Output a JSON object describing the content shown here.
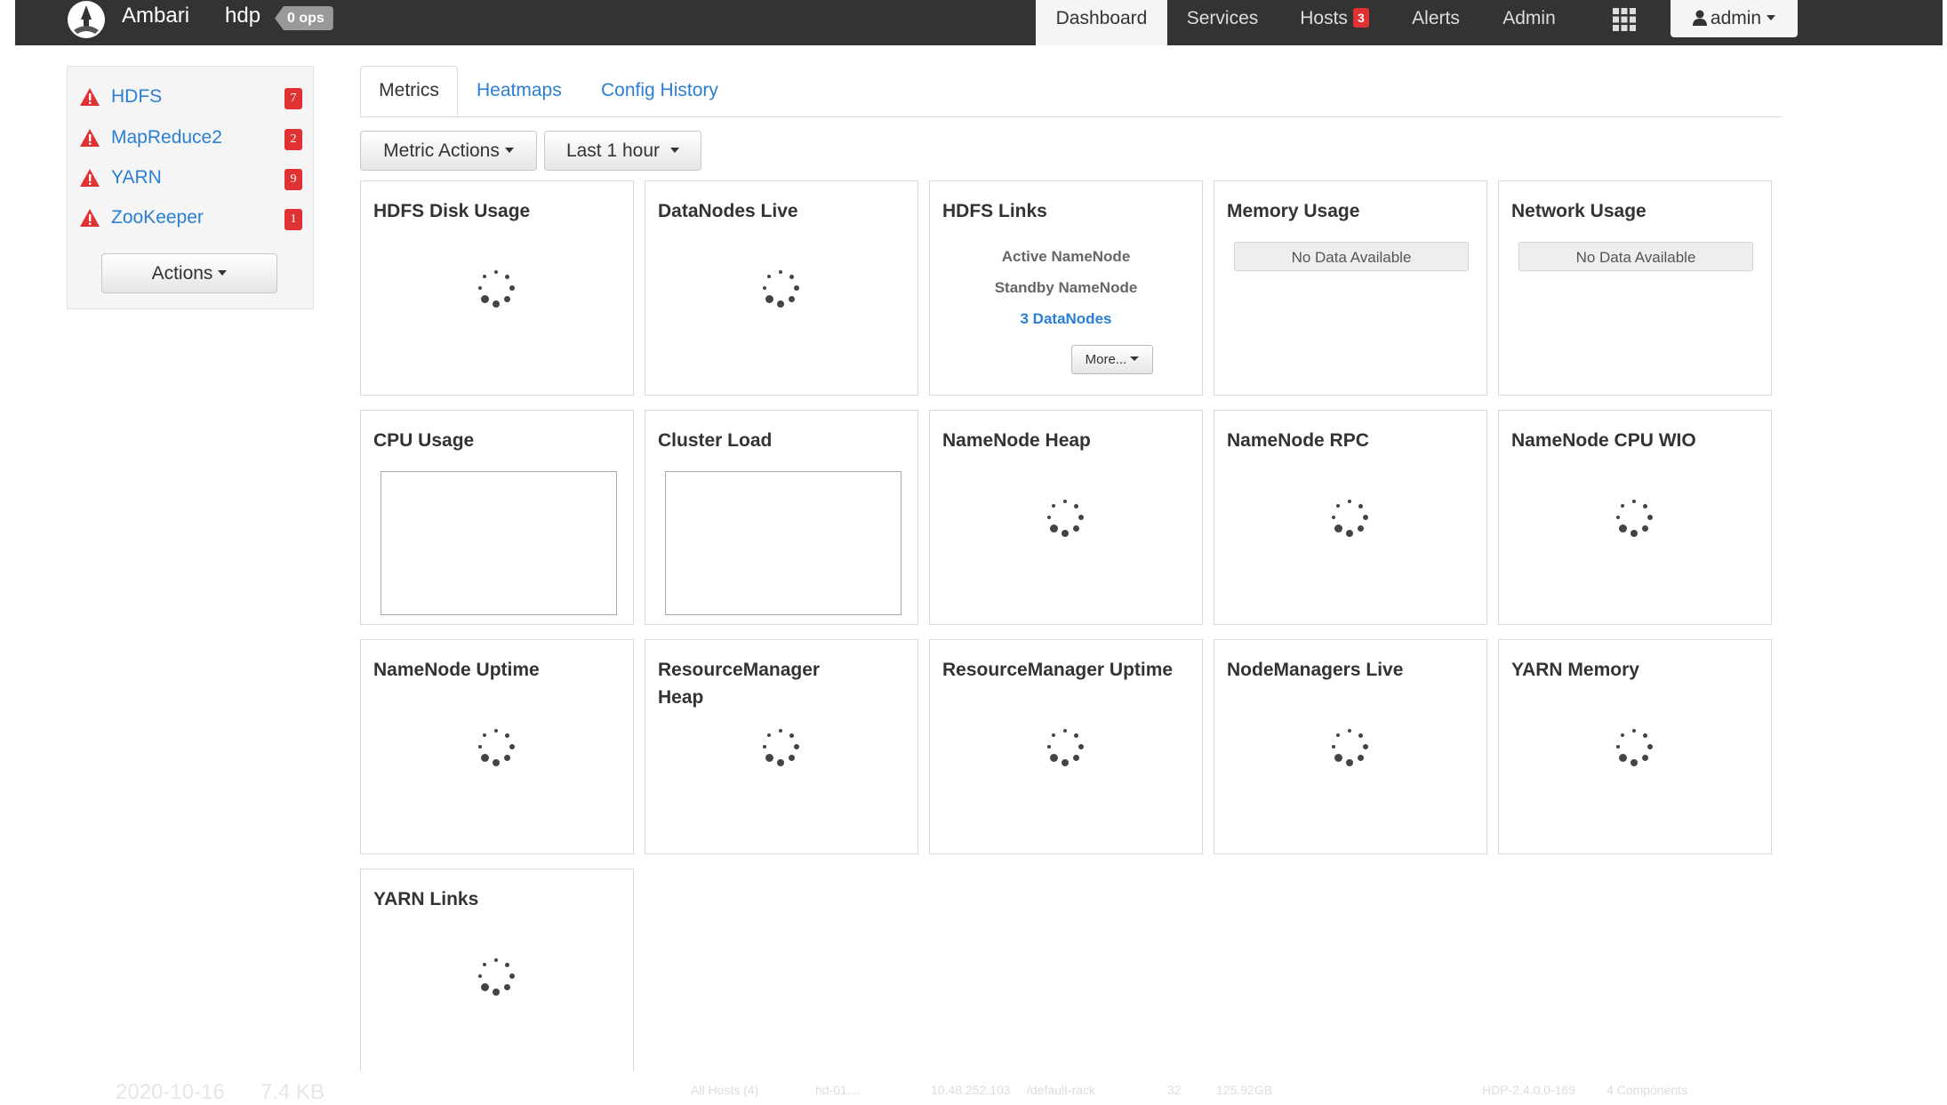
{
  "navbar": {
    "brand": "Ambari",
    "cluster": "hdp",
    "ops_badge": "0 ops",
    "items": [
      {
        "label": "Dashboard",
        "active": true
      },
      {
        "label": "Services"
      },
      {
        "label": "Hosts",
        "badge": "3"
      },
      {
        "label": "Alerts"
      },
      {
        "label": "Admin"
      }
    ],
    "user": "admin",
    "icons": {
      "logo": "ambari-logo-icon",
      "apps": "grid-icon",
      "user": "user-icon"
    }
  },
  "sidebar": {
    "services": [
      {
        "name": "HDFS",
        "alerts": "7"
      },
      {
        "name": "MapReduce2",
        "alerts": "2"
      },
      {
        "name": "YARN",
        "alerts": "9"
      },
      {
        "name": "ZooKeeper",
        "alerts": "1"
      }
    ],
    "actions_label": "Actions"
  },
  "tabs": [
    "Metrics",
    "Heatmaps",
    "Config History"
  ],
  "toolbar": {
    "metric_actions": "Metric Actions",
    "time_range": "Last 1 hour"
  },
  "widgets": {
    "hdfs_disk_usage": "HDFS Disk Usage",
    "datanodes_live": "DataNodes Live",
    "hdfs_links": {
      "title": "HDFS Links",
      "active_namenode": "Active NameNode",
      "standby_namenode": "Standby NameNode",
      "datanodes": "3 DataNodes",
      "more": "More..."
    },
    "memory_usage": {
      "title": "Memory Usage",
      "status": "No Data Available"
    },
    "network_usage": {
      "title": "Network Usage",
      "status": "No Data Available"
    },
    "cpu_usage": "CPU Usage",
    "cluster_load": "Cluster Load",
    "namenode_heap": "NameNode Heap",
    "namenode_rpc": "NameNode RPC",
    "namenode_cpu_wio": "NameNode CPU WIO",
    "namenode_uptime": "NameNode Uptime",
    "resourcemanager_heap": "ResourceManager Heap",
    "resourcemanager_uptime": "ResourceManager Uptime",
    "nodemanagers_live": "NodeManagers Live",
    "yarn_memory": "YARN Memory",
    "yarn_links": "YARN Links"
  },
  "faded_footer": {
    "date": "2020-10-16",
    "size": "7.4 KB",
    "all_hosts": "All Hosts (4)",
    "host": "hd-01....",
    "ip": "10.48.252.103",
    "rack": "/default-rack",
    "cores": "32",
    "ram": "125.92GB",
    "version": "HDP-2.4.0.0-169",
    "components": "4 Components"
  },
  "colors": {
    "navbar": "#333333",
    "link": "#2a7fd4",
    "alert": "#e03232"
  }
}
